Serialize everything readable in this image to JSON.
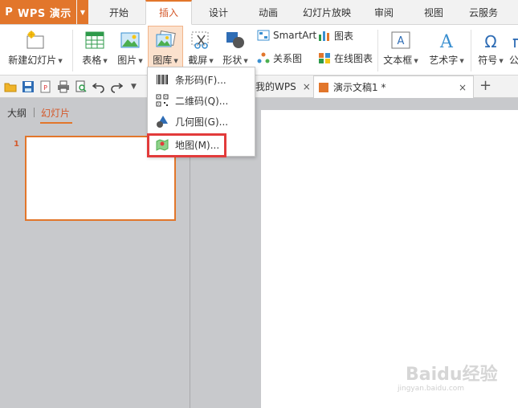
{
  "app": {
    "name": "WPS 演示",
    "logo": "P"
  },
  "ribbon_tabs": [
    "开始",
    "插入",
    "设计",
    "动画",
    "幻灯片放映",
    "审阅",
    "视图",
    "云服务"
  ],
  "active_tab": "插入",
  "ribbon": {
    "new_slide": "新建幻灯片",
    "table": "表格",
    "picture": "图片",
    "gallery": "图库",
    "screenshot": "截屏",
    "shapes": "形状",
    "smartart": "SmartArt",
    "relation_chart": "关系图",
    "chart": "图表",
    "online_chart": "在线图表",
    "textbox": "文本框",
    "wordart": "艺术字",
    "symbol": "符号",
    "formula_partial": "公"
  },
  "doc_tabs": {
    "mywps": "我的WPS",
    "doc": "演示文稿1 *"
  },
  "left_panel": {
    "outline_tab": "大纲",
    "slides_tab": "幻灯片",
    "slide_number": "1"
  },
  "dropdown": {
    "items": [
      {
        "label": "条形码(F)...",
        "icon": "barcode-icon"
      },
      {
        "label": "二维码(Q)...",
        "icon": "qrcode-icon"
      },
      {
        "label": "几何图(G)...",
        "icon": "geometry-icon"
      },
      {
        "label": "地图(M)...",
        "icon": "map-icon"
      }
    ]
  },
  "watermark": {
    "text": "Baidu经验",
    "sub": "jingyan.baidu.com"
  },
  "colors": {
    "accent": "#e2762b",
    "highlight": "#e23b3b",
    "workspace": "#c8c9cc"
  }
}
